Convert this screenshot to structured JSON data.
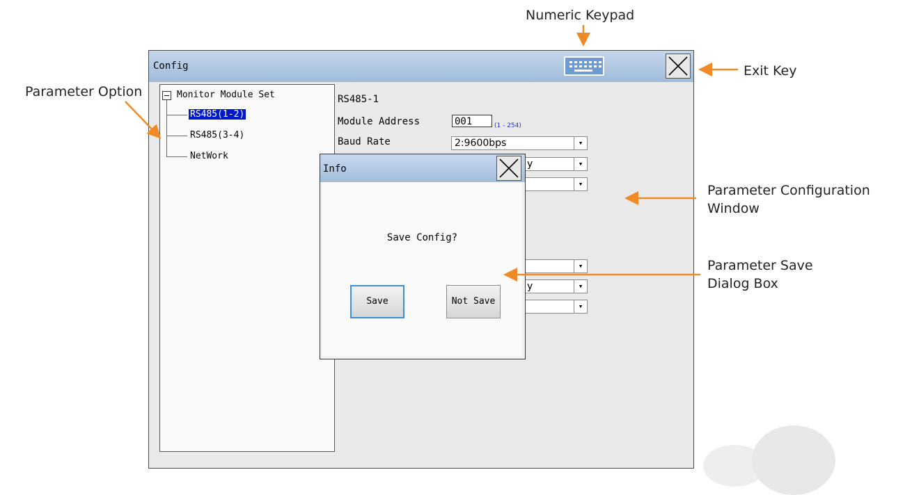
{
  "annotations": {
    "numeric_keypad": "Numeric Keypad",
    "exit_key": "Exit Key",
    "parameter_option": "Parameter Option",
    "param_config_window_line1": "Parameter Configuration",
    "param_config_window_line2": "Window",
    "param_save_dialog_line1": "Parameter Save",
    "param_save_dialog_line2": "Dialog Box"
  },
  "colors": {
    "annotation_arrow": "#f08a24",
    "tree_selection": "#0018cc",
    "range_hint": "#1f33c8",
    "titlebar": "#a9c2df",
    "focus_border": "#3a8fd6"
  },
  "window": {
    "title": "Config",
    "keypad_icon": "keyboard-icon",
    "close_icon": "close-icon"
  },
  "tree": {
    "root": "Monitor Module Set",
    "expander": "−",
    "items": [
      {
        "label": "RS485(1-2)",
        "selected": true
      },
      {
        "label": "RS485(3-4)",
        "selected": false
      },
      {
        "label": "NetWork",
        "selected": false
      }
    ]
  },
  "config": {
    "section": "RS485-1",
    "module_address_label": "Module Address",
    "module_address_value": "001",
    "module_address_range": "(1 - 254)",
    "baud_rate_label": "Baud Rate",
    "baud_rate_value": "2:9600bps",
    "partial_combo_text_1": "y",
    "partial_combo_text_2": "y"
  },
  "dialog": {
    "title": "Info",
    "message": "Save Config?",
    "save_label": "Save",
    "not_save_label": "Not Save"
  }
}
